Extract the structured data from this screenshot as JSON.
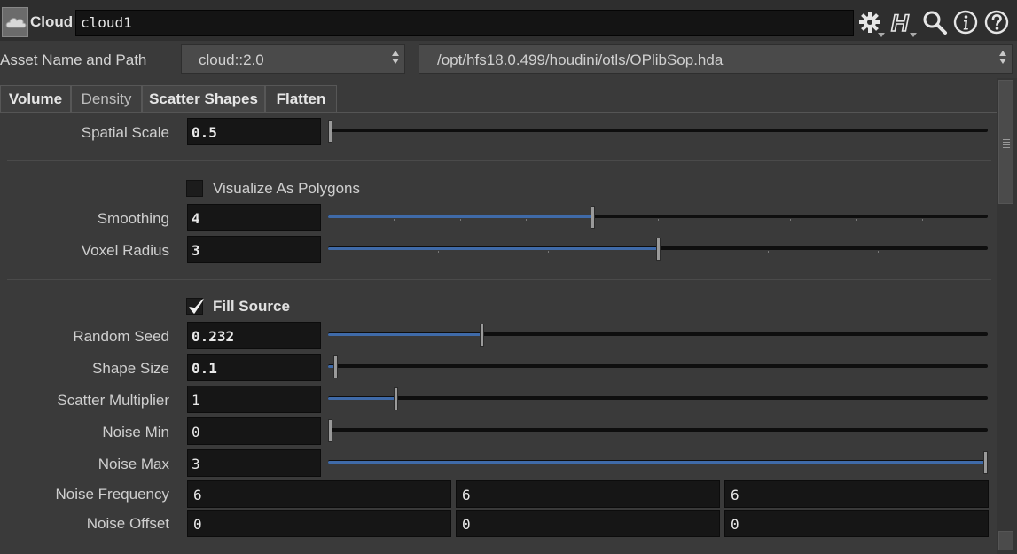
{
  "header": {
    "node_type": "Cloud",
    "node_name": "cloud1",
    "icons": [
      "cloud-node-icon",
      "gear-icon",
      "houdini-help-icon",
      "search-icon",
      "info-icon",
      "help-icon"
    ]
  },
  "asset": {
    "label": "Asset Name and Path",
    "name": "cloud::2.0",
    "path": "/opt/hfs18.0.499/houdini/otls/OPlibSop.hda"
  },
  "tabs": [
    "Volume",
    "Density",
    "Scatter Shapes",
    "Flatten"
  ],
  "active_tab": "Scatter Shapes",
  "params": {
    "spatial_scale": {
      "label": "Spatial Scale",
      "value": "0.5",
      "slider_fraction": 0.0
    },
    "visualize_as_polygons": {
      "label": "Visualize As Polygons",
      "checked": false
    },
    "smoothing": {
      "label": "Smoothing",
      "value": "4",
      "slider_fraction": 0.4
    },
    "voxel_radius": {
      "label": "Voxel Radius",
      "value": "3",
      "slider_fraction": 0.5
    },
    "fill_source": {
      "label": "Fill Source",
      "checked": true
    },
    "random_seed": {
      "label": "Random Seed",
      "value": "0.232",
      "slider_fraction": 0.232
    },
    "shape_size": {
      "label": "Shape Size",
      "value": "0.1",
      "slider_fraction": 0.008
    },
    "scatter_multiplier": {
      "label": "Scatter Multiplier",
      "value": "1",
      "slider_fraction": 0.1
    },
    "noise_min": {
      "label": "Noise Min",
      "value": "0",
      "slider_fraction": 0.0
    },
    "noise_max": {
      "label": "Noise Max",
      "value": "3",
      "slider_fraction": 1.0
    },
    "noise_frequency": {
      "label": "Noise Frequency",
      "values": [
        "6",
        "6",
        "6"
      ]
    },
    "noise_offset": {
      "label": "Noise Offset",
      "values": [
        "0",
        "0",
        "0"
      ]
    }
  },
  "colors": {
    "background": "#3a3a3a",
    "field": "#161616",
    "slider_fill": "#3f6aa8",
    "track": "#0e0e0e"
  }
}
